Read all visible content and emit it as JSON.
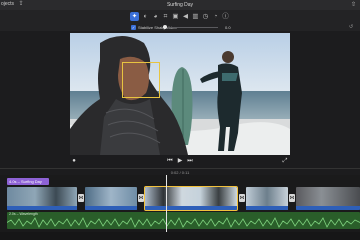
{
  "titlebar": {
    "left_label": "ojects",
    "title": "Surfing Day"
  },
  "stabilize": {
    "checked": true,
    "label": "Stabilize Shaky Video",
    "value": "0.0 "
  },
  "timeline": {
    "timecode": "0:02 / 0:11",
    "title_clip_label": "4.0s – Surfing Day",
    "audio_label": "2.0s – Wavelength"
  },
  "colors": {
    "accent": "#3a6fd8",
    "selection": "#f2c13c",
    "title_clip": "#8e62d6",
    "audio": "#2a5e2a",
    "face_box": "#e8c440"
  },
  "icons": {
    "toolbar": [
      "magic-wand-icon",
      "color-balance-icon",
      "color-correction-icon",
      "crop-icon",
      "stabilization-icon",
      "volume-icon",
      "noise-reduction-icon",
      "speed-icon",
      "filter-icon",
      "info-icon"
    ],
    "viewer": [
      "microphone-icon",
      "skip-back-icon",
      "play-icon",
      "skip-forward-icon",
      "fullscreen-icon"
    ]
  }
}
